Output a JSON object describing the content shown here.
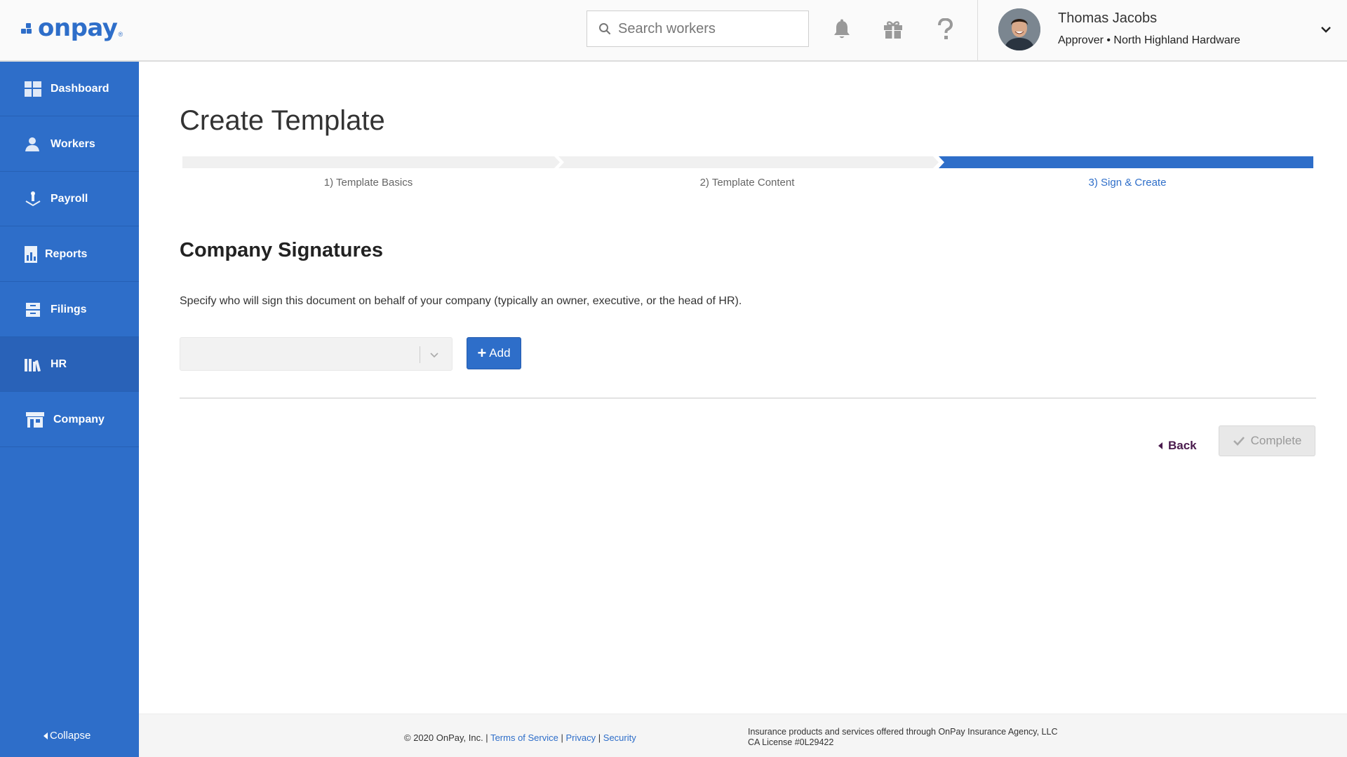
{
  "header": {
    "logo_text": "onpay",
    "logo_mark": "®",
    "search_placeholder": "Search workers",
    "icons": [
      "bell-icon",
      "gift-icon",
      "help-icon"
    ],
    "user": {
      "name": "Thomas Jacobs",
      "role": "Approver • North Highland Hardware"
    }
  },
  "sidebar": {
    "items": [
      {
        "label": "Dashboard",
        "icon": "dashboard-icon"
      },
      {
        "label": "Workers",
        "icon": "workers-icon"
      },
      {
        "label": "Payroll",
        "icon": "payroll-icon"
      },
      {
        "label": "Reports",
        "icon": "reports-icon"
      },
      {
        "label": "Filings",
        "icon": "filings-icon"
      },
      {
        "label": "HR",
        "icon": "hr-icon",
        "active": true
      },
      {
        "label": "Company",
        "icon": "company-icon"
      }
    ],
    "collapse_label": "Collapse"
  },
  "main": {
    "title": "Create Template",
    "steps": [
      {
        "label": "1) Template Basics",
        "state": "pending"
      },
      {
        "label": "2) Template Content",
        "state": "pending"
      },
      {
        "label": "3) Sign & Create",
        "state": "current"
      }
    ],
    "section_title": "Company Signatures",
    "description": "Specify who will sign this document on behalf of your company (typically an owner, executive, or the head of HR).",
    "signer_select_value": "",
    "add_label": "Add",
    "back_label": "Back",
    "complete_label": "Complete"
  },
  "footer": {
    "copyright": "© 2020 OnPay, Inc. |",
    "terms": "Terms of Service",
    "sep1": "|",
    "privacy": "Privacy",
    "sep2": "|",
    "security": "Security",
    "insurance_line1": "Insurance products and services offered through OnPay Insurance Agency, LLC",
    "insurance_line2": "CA License #0L29422"
  },
  "colors": {
    "brand_blue": "#2e6ec9",
    "sidebar_active": "#2962b8",
    "step_inactive": "#f0f0f0",
    "back_text": "#4a1b4d"
  }
}
